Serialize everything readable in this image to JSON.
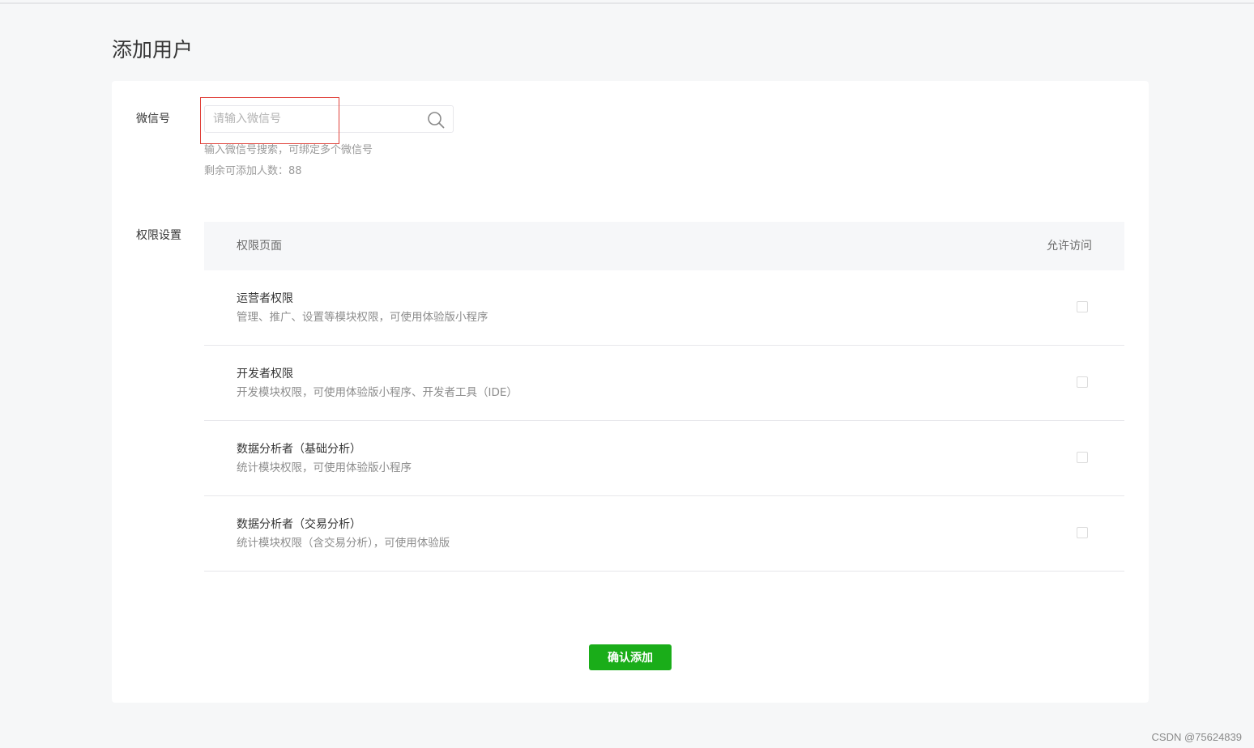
{
  "page": {
    "title": "添加用户"
  },
  "wechat": {
    "label": "微信号",
    "placeholder": "请输入微信号",
    "value": "",
    "tip": "输入微信号搜索，可绑定多个微信号",
    "remaining": "剩余可添加人数：88"
  },
  "permissions": {
    "label": "权限设置",
    "header_page": "权限页面",
    "header_allow": "允许访问",
    "rows": [
      {
        "title": "运营者权限",
        "desc": "管理、推广、设置等模块权限，可使用体验版小程序",
        "checked": false
      },
      {
        "title": "开发者权限",
        "desc": "开发模块权限，可使用体验版小程序、开发者工具（IDE）",
        "checked": false
      },
      {
        "title": "数据分析者（基础分析）",
        "desc": "统计模块权限，可使用体验版小程序",
        "checked": false
      },
      {
        "title": "数据分析者（交易分析）",
        "desc": "统计模块权限（含交易分析），可使用体验版",
        "checked": false
      }
    ]
  },
  "actions": {
    "confirm_label": "确认添加"
  },
  "watermark": "CSDN @75624839",
  "icons": {
    "search": "search-icon"
  },
  "colors": {
    "primary": "#1aad19",
    "highlight": "#e0413a"
  }
}
